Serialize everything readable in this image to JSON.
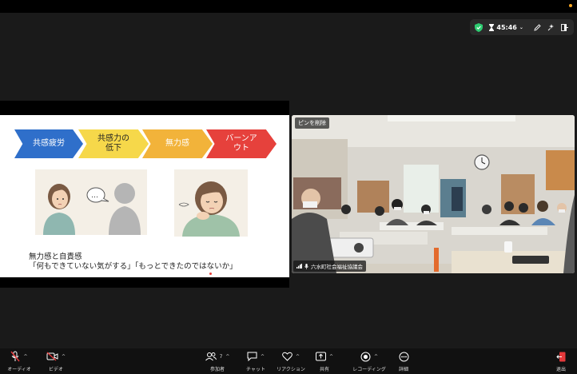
{
  "window": {
    "indicator_color": "#f5a623"
  },
  "top_bar": {
    "timer": "45:46",
    "icons": [
      "shield-check-icon",
      "hourglass-icon",
      "chevron-down-icon",
      "pencil-icon",
      "sparkle-icon",
      "exit-panel-icon"
    ]
  },
  "slide": {
    "steps": [
      "共感疲労",
      "共感力の\n低下",
      "無力感",
      "バーンア\nウト"
    ],
    "bubble": "…",
    "line1": "無力感と自責感",
    "line2": "「何もできていない気がする」「もっとできたのではないか」"
  },
  "video": {
    "pin_label": "ピンを削除",
    "participant_label": "六水町社会福祉協議会"
  },
  "toolbar": {
    "audio": "オーディオ",
    "video": "ビデオ",
    "participants": "参加者",
    "participants_count": "7",
    "chat": "チャット",
    "reaction": "リアクション",
    "share": "共有",
    "recording": "レコーディング",
    "details": "詳細",
    "leave": "退出"
  },
  "colors": {
    "blue": "#2f6fca",
    "yellow": "#f6d84a",
    "orange": "#f2b33a",
    "red": "#e6413c",
    "leave_red": "#e5393b",
    "shield_green": "#2ecc71"
  }
}
